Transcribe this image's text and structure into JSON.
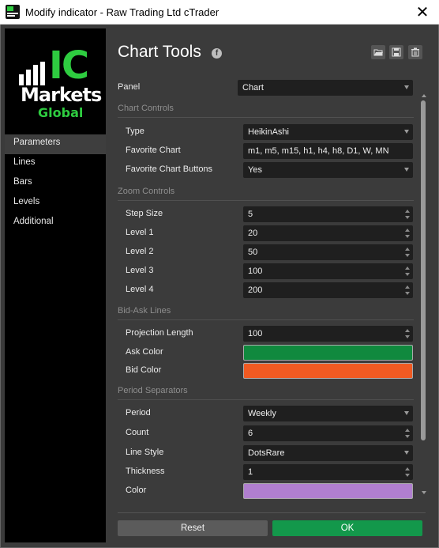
{
  "window": {
    "title": "Modify indicator - Raw Trading Ltd cTrader",
    "close_glyph": "✕"
  },
  "logo": {
    "line1": "IC",
    "line2": "Markets",
    "line3": "Global"
  },
  "sidebar": {
    "items": [
      {
        "label": "Parameters",
        "active": true
      },
      {
        "label": "Lines"
      },
      {
        "label": "Bars"
      },
      {
        "label": "Levels"
      },
      {
        "label": "Additional"
      }
    ]
  },
  "header": {
    "title": "Chart Tools",
    "icons": [
      "facebook-icon",
      "folder-open-icon",
      "save-icon",
      "trash-icon"
    ]
  },
  "form": {
    "panel": {
      "label": "Panel",
      "value": "Chart"
    },
    "chart_controls": {
      "heading": "Chart Controls",
      "type": {
        "label": "Type",
        "value": "HeikinAshi"
      },
      "favorite_chart": {
        "label": "Favorite Chart",
        "value": "m1, m5, m15, h1, h4, h8, D1, W, MN"
      },
      "favorite_buttons": {
        "label": "Favorite Chart Buttons",
        "value": "Yes"
      }
    },
    "zoom_controls": {
      "heading": "Zoom Controls",
      "step_size": {
        "label": "Step Size",
        "value": "5"
      },
      "level1": {
        "label": "Level 1",
        "value": "20"
      },
      "level2": {
        "label": "Level 2",
        "value": "50"
      },
      "level3": {
        "label": "Level 3",
        "value": "100"
      },
      "level4": {
        "label": "Level 4",
        "value": "200"
      }
    },
    "bid_ask": {
      "heading": "Bid-Ask Lines",
      "projection": {
        "label": "Projection Length",
        "value": "100"
      },
      "ask_color": {
        "label": "Ask Color",
        "color": "#10893e"
      },
      "bid_color": {
        "label": "Bid Color",
        "color": "#f05a22"
      }
    },
    "period_separators": {
      "heading": "Period Separators",
      "period": {
        "label": "Period",
        "value": "Weekly"
      },
      "count": {
        "label": "Count",
        "value": "6"
      },
      "line_style": {
        "label": "Line Style",
        "value": "DotsRare"
      },
      "thickness": {
        "label": "Thickness",
        "value": "1"
      },
      "color": {
        "label": "Color",
        "color": "#b07fcf"
      }
    }
  },
  "buttons": {
    "reset": "Reset",
    "ok": "OK"
  },
  "colors": {
    "accent": "#13984b",
    "background": "#3b3b3b",
    "field_bg": "#1f1f1f"
  }
}
